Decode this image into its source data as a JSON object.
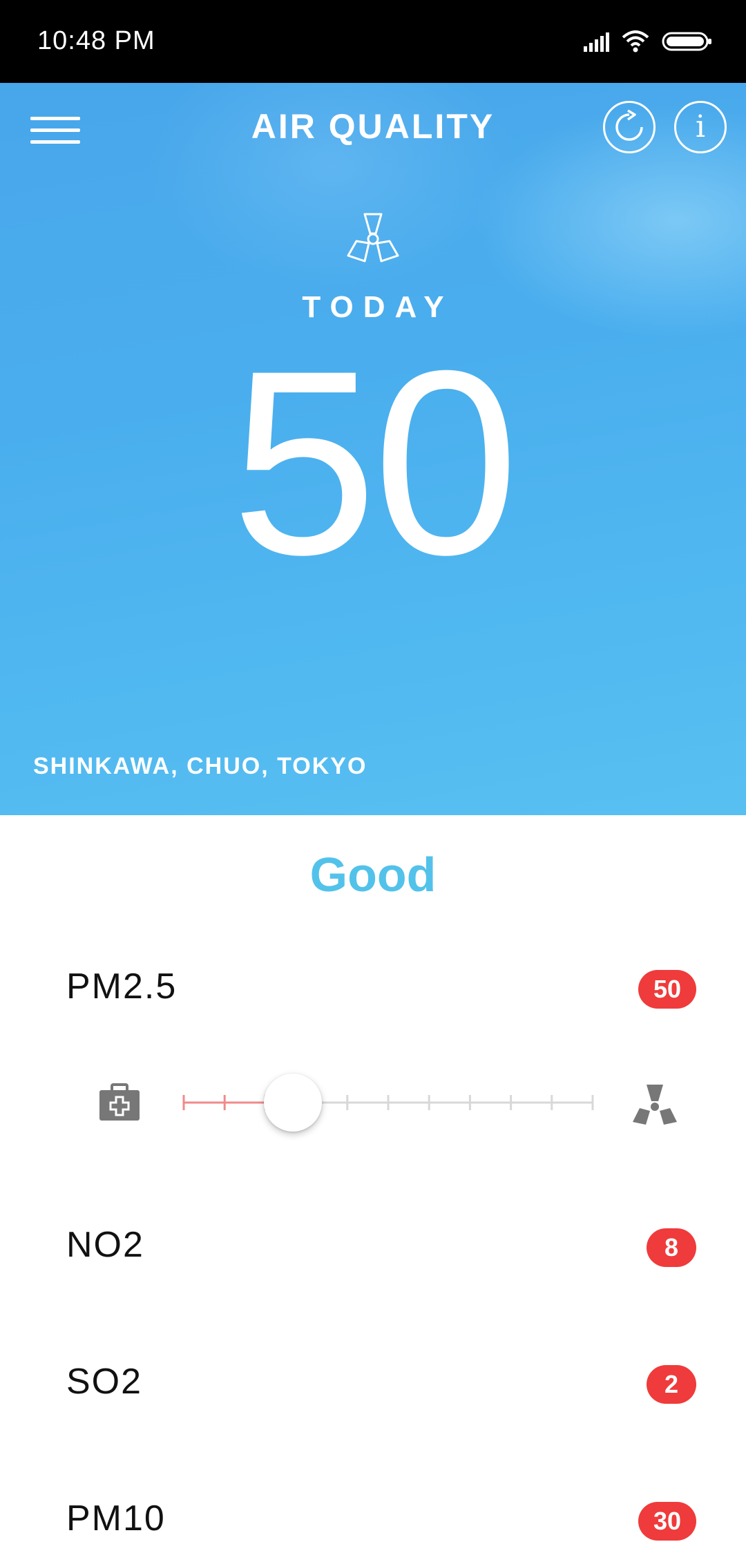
{
  "status_bar": {
    "time": "10:48  PM",
    "icons": [
      "signal-icon",
      "wifi-icon",
      "battery-icon"
    ]
  },
  "header": {
    "title": "AIR QUALITY",
    "menu_icon": "hamburger-menu-icon",
    "refresh_icon": "refresh-icon",
    "info_icon": "info-icon",
    "info_glyph": "i"
  },
  "hero": {
    "icon": "fan-icon",
    "today_label": "TODAY",
    "aqi_value": "50",
    "location": "SHINKAWA, CHUO, TOKYO"
  },
  "status": {
    "label": "Good",
    "color": "#52c2ea"
  },
  "pollutants": [
    {
      "name": "PM2.5",
      "value": "50"
    },
    {
      "name": "NO2",
      "value": "8"
    },
    {
      "name": "SO2",
      "value": "2"
    },
    {
      "name": "PM10",
      "value": "30"
    }
  ],
  "slider": {
    "left_icon": "first-aid-kit-icon",
    "right_icon": "radiation-icon",
    "level": 0.2,
    "segments": 10
  },
  "colors": {
    "hero_blue": "#4aaeee",
    "badge_red": "#ef3b3b",
    "slider_active": "#f08a8a",
    "slider_inactive": "#d8d8d8"
  }
}
